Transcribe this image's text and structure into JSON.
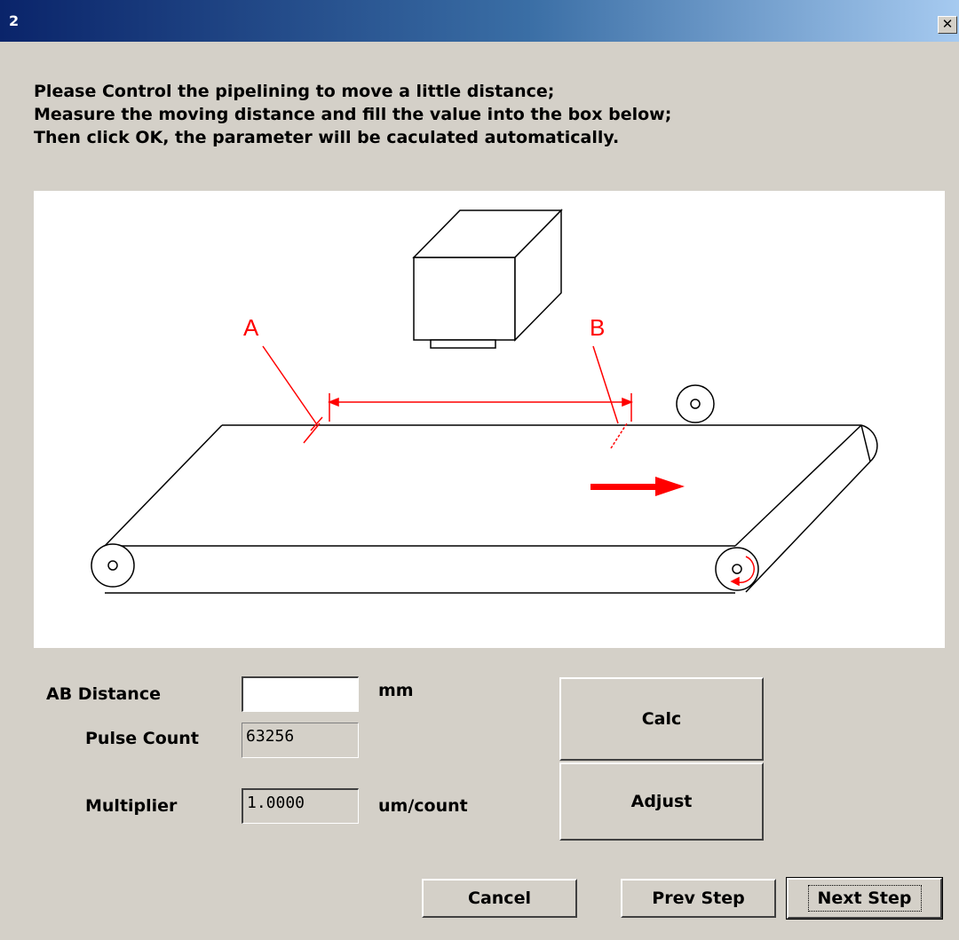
{
  "window": {
    "title": "2",
    "close_glyph": "✕"
  },
  "instructions": [
    "Please Control the pipelining to move a little distance;",
    "Measure the moving distance and fill the value into the box below;",
    "Then click OK, the parameter will be caculated automatically."
  ],
  "diagram": {
    "point_a_label": "A",
    "point_b_label": "B",
    "accent_color": "#ff0000"
  },
  "form": {
    "ab_distance_label": "AB Distance",
    "ab_distance_value": "",
    "ab_distance_unit": "mm",
    "pulse_count_label": "Pulse Count",
    "pulse_count_value": "63256",
    "multiplier_label": "Multiplier",
    "multiplier_value": "1.0000",
    "multiplier_unit": "um/count"
  },
  "buttons": {
    "calc": "Calc",
    "adjust": "Adjust",
    "cancel": "Cancel",
    "prev_step": "Prev Step",
    "next_step": "Next Step"
  }
}
